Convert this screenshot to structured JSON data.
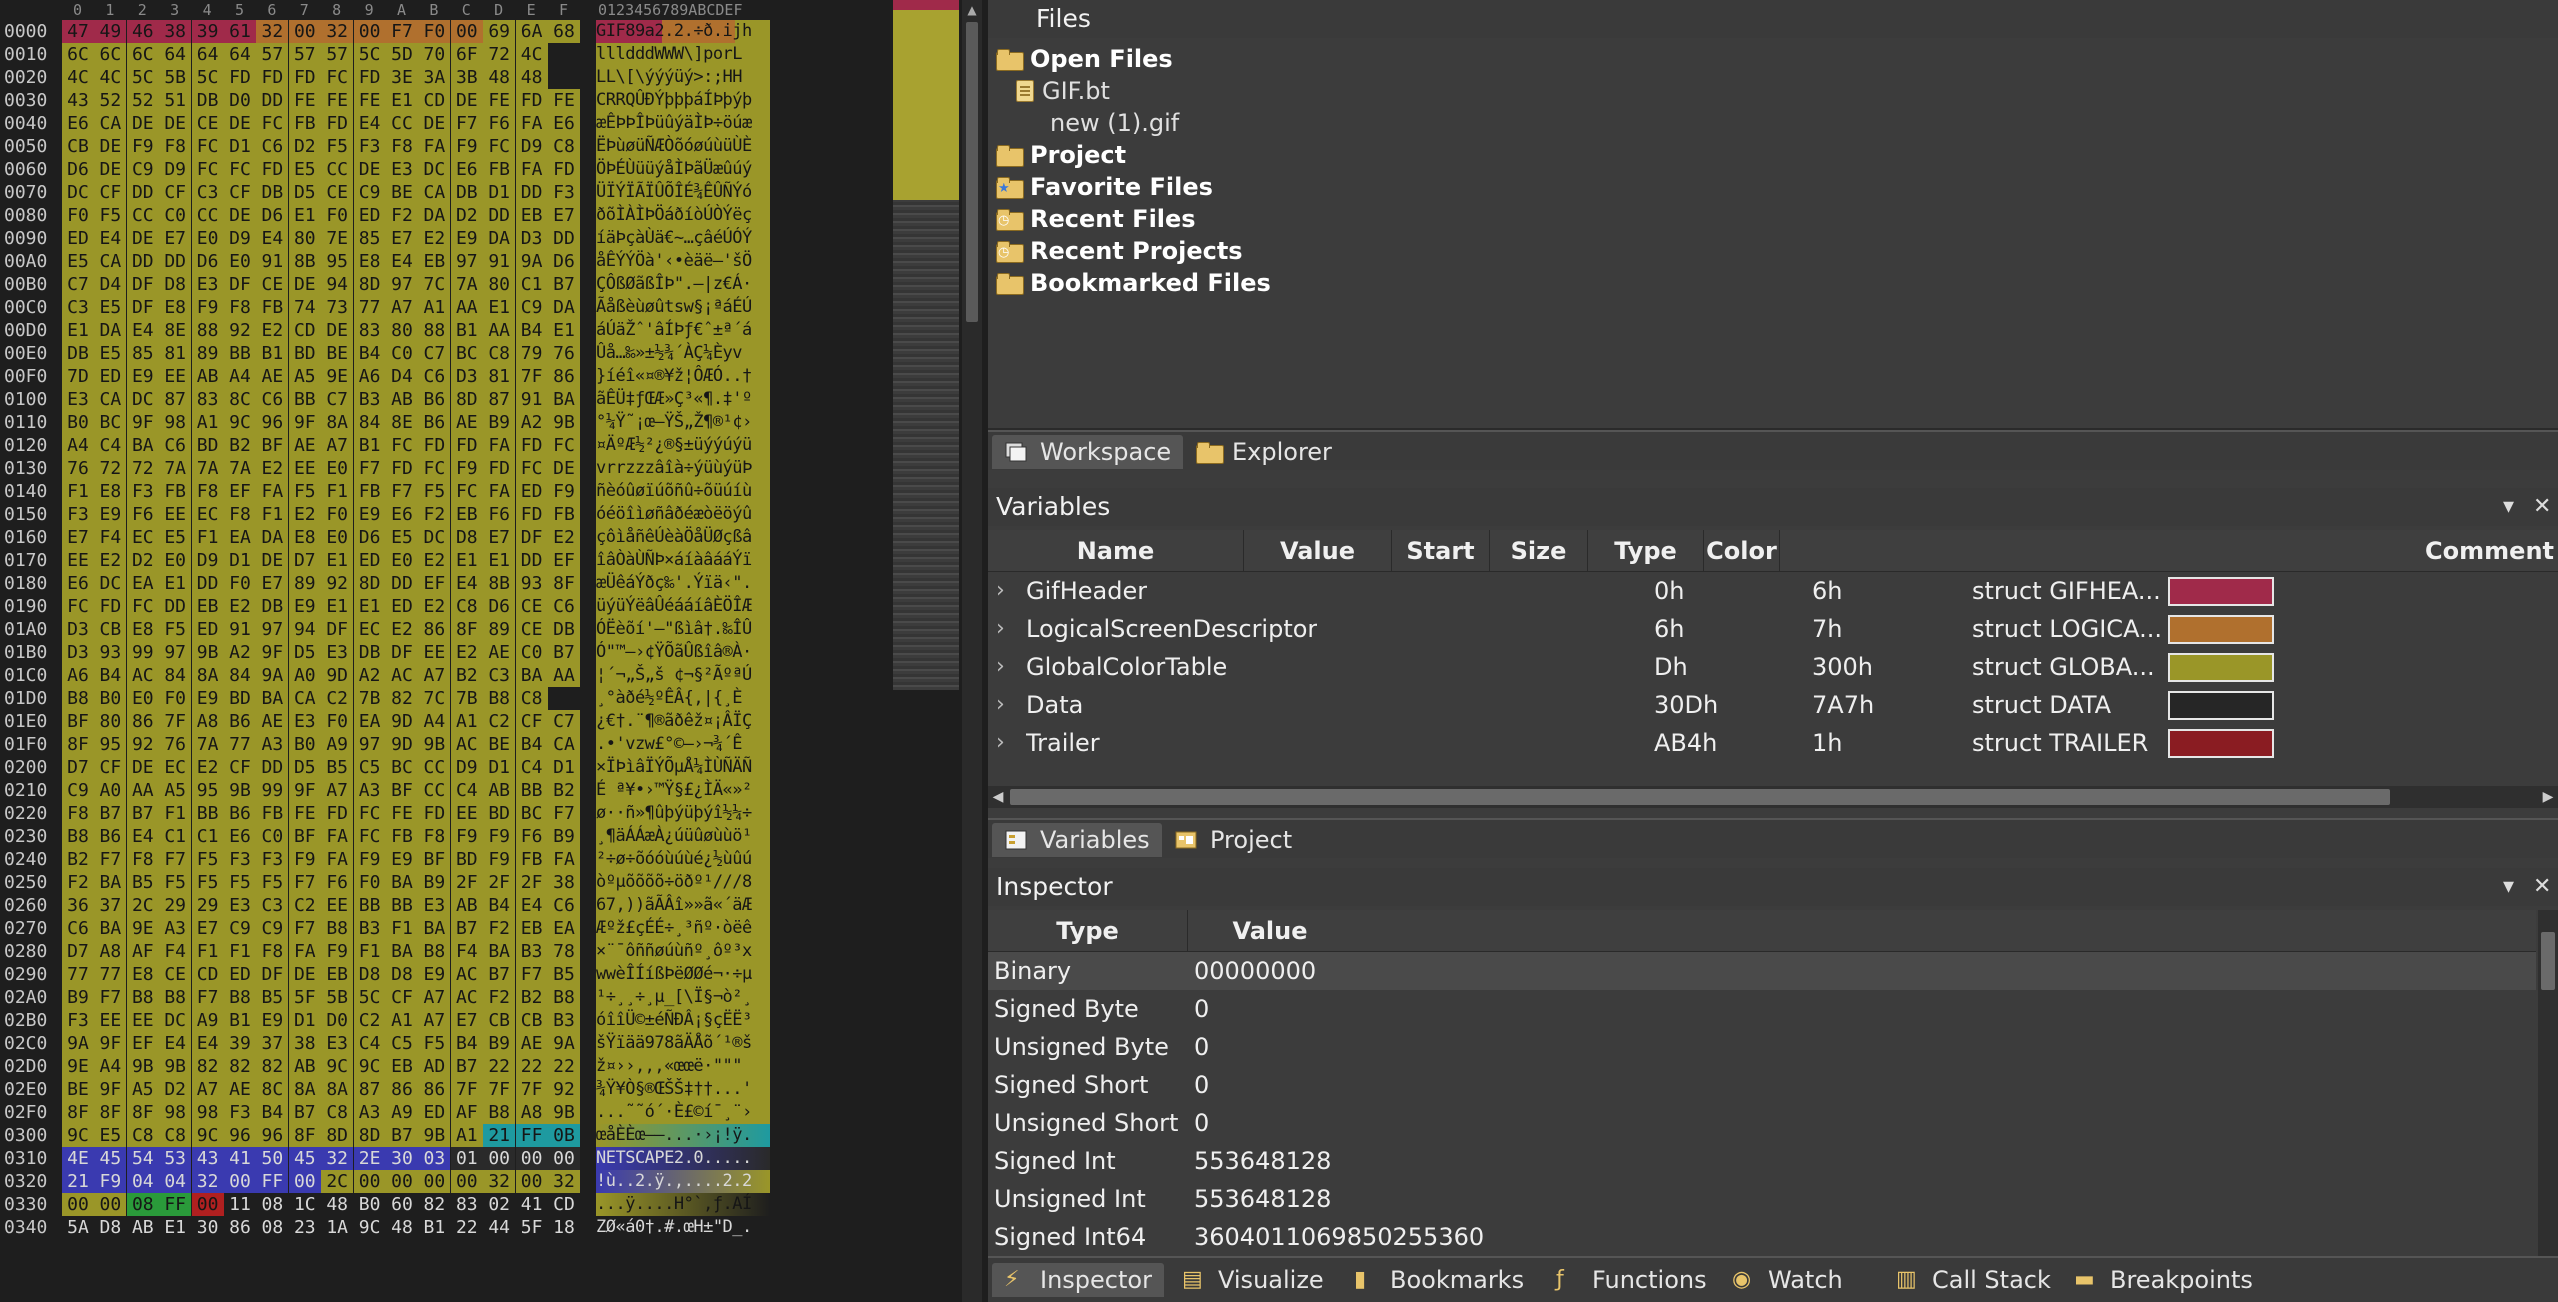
{
  "hex": {
    "column_headers": [
      "0",
      "1",
      "2",
      "3",
      "4",
      "5",
      "6",
      "7",
      "8",
      "9",
      "A",
      "B",
      "C",
      "D",
      "E",
      "F"
    ],
    "ascii_header": "0123456789ABCDEF",
    "rows": [
      {
        "addr": "0000",
        "bytes": "47 49 46 38 39 61 32 00 32 00 F7 F0 00 69 6A 68",
        "ascii": "GIF89a2.2.÷ð.ijh"
      },
      {
        "addr": "0010",
        "bytes": "6C 6C 6C 64 64 64 57 57 57 5C 5D 70 6F 72 4C",
        "ascii": "llldddWWW\\]porL"
      },
      {
        "addr": "0020",
        "bytes": "4C 4C 5C 5B 5C FD FD FD FC FD 3E 3A 3B 48 48",
        "ascii": "LL\\[\\ýýýüý>:;HH"
      },
      {
        "addr": "0030",
        "bytes": "43 52 52 51 DB D0 DD FE FE FE E1 CD DE FE FD FE",
        "ascii": "CRRQÛÐÝþþþáÍÞþýþ"
      },
      {
        "addr": "0040",
        "bytes": "E6 CA DE DE CE DE FC FB FD E4 CC DE F7 F6 FA E6",
        "ascii": "æÊÞÞÎÞüûýäÌÞ÷öúæ"
      },
      {
        "addr": "0050",
        "bytes": "CB DE F9 F8 FC D1 C6 D2 F5 F3 F8 FA F9 FC D9 C8",
        "ascii": "ËÞùøüÑÆÒõóøúùüÙÈ"
      },
      {
        "addr": "0060",
        "bytes": "D6 DE C9 D9 FC FC FD E5 CC DE E3 DC E6 FB FA FD",
        "ascii": "ÖÞÉÙüüýåÌÞãÜæûúý"
      },
      {
        "addr": "0070",
        "bytes": "DC CF DD CF C3 CF DB D5 CE C9 BE CA DB D1 DD F3",
        "ascii": "ÜÏÝÏÃÏÛÕÎÉ¾ÊÛÑÝó"
      },
      {
        "addr": "0080",
        "bytes": "F0 F5 CC C0 CC DE D6 E1 F0 ED F2 DA D2 DD EB E7",
        "ascii": "ðõÌÀÌÞÖáðíòÚÒÝëç"
      },
      {
        "addr": "0090",
        "bytes": "ED E4 DE E7 E0 D9 E4 80 7E 85 E7 E2 E9 DA D3 DD",
        "ascii": "íäÞçàÙä€~…çâéÚÓÝ"
      },
      {
        "addr": "00A0",
        "bytes": "E5 CA DD DD D6 E0 91 8B 95 E8 E4 EB 97 91 9A D6",
        "ascii": "åÊÝÝÖà'‹•èäë—'šÖ"
      },
      {
        "addr": "00B0",
        "bytes": "C7 D4 DF D8 E3 DF CE DE 94 8D 97 7C 7A 80 C1 B7",
        "ascii": "ÇÔßØãßÎÞ\".—|z€Á·"
      },
      {
        "addr": "00C0",
        "bytes": "C3 E5 DF E8 F9 F8 FB 74 73 77 A7 A1 AA E1 C9 DA",
        "ascii": "Ãåßèùøûtsw§¡ªáÉÚ"
      },
      {
        "addr": "00D0",
        "bytes": "E1 DA E4 8E 88 92 E2 CD DE 83 80 88 B1 AA B4 E1",
        "ascii": "áÚäŽˆ'âÍÞƒ€ˆ±ª´á"
      },
      {
        "addr": "00E0",
        "bytes": "DB E5 85 81 89 BB B1 BD BE B4 C0 C7 BC C8 79 76",
        "ascii": "Ûå…‰»±½¾´ÀÇ¼Èyv"
      },
      {
        "addr": "00F0",
        "bytes": "7D ED E9 EE AB A4 AE A5 9E A6 D4 C6 D3 81 7F 86",
        "ascii": "}íéî«¤®¥ž¦ÔÆÓ..†"
      },
      {
        "addr": "0100",
        "bytes": "E3 CA DC 87 83 8C C6 BB C7 B3 AB B6 8D 87 91 BA",
        "ascii": "ãÊÜ‡ƒŒÆ»Ç³«¶.‡'º"
      },
      {
        "addr": "0110",
        "bytes": "B0 BC 9F 98 A1 9C 96 9F 8A 84 8E B6 AE B9 A2 9B",
        "ascii": "°¼Ÿ˜¡œ–ŸŠ„Ž¶®¹¢›"
      },
      {
        "addr": "0120",
        "bytes": "A4 C4 BA C6 BD B2 BF AE A7 B1 FC FD FD FA FD FC",
        "ascii": "¤ÄºÆ½²¿®§±üýýúýü"
      },
      {
        "addr": "0130",
        "bytes": "76 72 72 7A 7A 7A E2 EE E0 F7 FD FC F9 FD FC DE",
        "ascii": "vrrzzzâîà÷ýüùýüÞ"
      },
      {
        "addr": "0140",
        "bytes": "F1 E8 F3 FB F8 EF FA F5 F1 FB F7 F5 FC FA ED F9",
        "ascii": "ñèóûøïúõñû÷õüúíù"
      },
      {
        "addr": "0150",
        "bytes": "F3 E9 F6 EE EC F8 F1 E2 F0 E9 E6 F2 EB F6 FD FB",
        "ascii": "óéöîìøñâðéæòëöýû"
      },
      {
        "addr": "0160",
        "bytes": "E7 F4 EC E5 F1 EA DA E8 E0 D6 E5 DC D8 E7 DF E2",
        "ascii": "çôìåñêÚèàÖåÜØçßâ"
      },
      {
        "addr": "0170",
        "bytes": "EE E2 D2 E0 D9 D1 DE D7 E1 ED E0 E2 E1 E1 DD EF",
        "ascii": "îâÒàÙÑÞ×áíàâááÝï"
      },
      {
        "addr": "0180",
        "bytes": "E6 DC EA E1 DD F0 E7 89 92 8D DD EF E4 8B 93 8F",
        "ascii": "æÜêáÝðç‰'.Ýïä‹\"."
      },
      {
        "addr": "0190",
        "bytes": "FC FD FC DD EB E2 DB E9 E1 E1 ED E2 C8 D6 CE C6",
        "ascii": "üýüÝëâÛéááíâÈÖÎÆ"
      },
      {
        "addr": "01A0",
        "bytes": "D3 CB E8 F5 ED 91 97 94 DF EC E2 86 8F 89 CE DB",
        "ascii": "ÓËèõí'—\"ßìâ†.‰ÎÛ"
      },
      {
        "addr": "01B0",
        "bytes": "D3 93 99 97 9B A2 9F D5 E3 DB DF EE E2 AE C0 B7",
        "ascii": "Ó\"™—›¢ŸÕãÛßîâ®À·"
      },
      {
        "addr": "01C0",
        "bytes": "A6 B4 AC 84 8A 84 9A A0 9D A2 AC A7 B2 C3 BA AA",
        "ascii": "¦´¬„Š„š ¢¬§²ÃºªÚ"
      },
      {
        "addr": "01D0",
        "bytes": "B8 B0 E0 F0 E9 BD BA CA C2 7B 82 7C 7B B8 C8",
        "ascii": "¸°àðé½ºÊÂ{‚|{¸È"
      },
      {
        "addr": "01E0",
        "bytes": "BF 80 86 7F A8 B6 AE E3 F0 EA 9D A4 A1 C2 CF C7",
        "ascii": "¿€†.¨¶®ãðêž¤¡ÂÏÇ"
      },
      {
        "addr": "01F0",
        "bytes": "8F 95 92 76 7A 77 A3 B0 A9 97 9D 9B AC BE B4 CA",
        "ascii": ".•'vzw£°©—›¬¾´Ê"
      },
      {
        "addr": "0200",
        "bytes": "D7 CF DE EC E2 CF DD D5 B5 C5 BC CC D9 D1 C4 D1",
        "ascii": "×ÏÞìâÏÝÕµÅ¼ÌÙÑÄÑ"
      },
      {
        "addr": "0210",
        "bytes": "C9 A0 AA A5 95 9B 99 9F A7 A3 BF CC C4 AB BB B2",
        "ascii": "É ª¥•›™Ÿ§£¿ÌÄ«»²"
      },
      {
        "addr": "0220",
        "bytes": "F8 B7 B7 F1 BB B6 FB FE FD FC FE FD EE BD BC F7",
        "ascii": "ø··ñ»¶ûþýüþýî½¼÷"
      },
      {
        "addr": "0230",
        "bytes": "B8 B6 E4 C1 C1 E6 C0 BF FA FC FB F8 F9 F9 F6 B9",
        "ascii": "¸¶äÁÁæÀ¿úüûøùùö¹"
      },
      {
        "addr": "0240",
        "bytes": "B2 F7 F8 F7 F5 F3 F3 F9 FA F9 E9 BF BD F9 FB FA",
        "ascii": "²÷ø÷õóóùúùé¿½ùûú"
      },
      {
        "addr": "0250",
        "bytes": "F2 BA B5 F5 F5 F5 F5 F7 F6 F0 BA B9 2F 2F 2F 38",
        "ascii": "òºµõõõõ÷öðº¹///8"
      },
      {
        "addr": "0260",
        "bytes": "36 37 2C 29 29 E3 C3 C2 EE BB BB E3 AB B4 E4 C6",
        "ascii": "67,))ãÃÂî»»ã«´äÆ"
      },
      {
        "addr": "0270",
        "bytes": "C6 BA 9E A3 E7 C9 C9 F7 B8 B3 F1 BA B7 F2 EB EA",
        "ascii": "Æºž£çÉÉ÷¸³ñº·òëê"
      },
      {
        "addr": "0280",
        "bytes": "D7 A8 AF F4 F1 F1 F8 FA F9 F1 BA B8 F4 BA B3 78",
        "ascii": "×¨¯ôññøúùñº¸ôº³x"
      },
      {
        "addr": "0290",
        "bytes": "77 77 E8 CE CD ED DF DE EB D8 D8 E9 AC B7 F7 B5",
        "ascii": "wwèÎÍíßÞëØØé¬·÷µ"
      },
      {
        "addr": "02A0",
        "bytes": "B9 F7 B8 B8 F7 B8 B5 5F 5B 5C CF A7 AC F2 B2 B8",
        "ascii": "¹÷¸¸÷¸µ_[\\Ï§¬ò²¸"
      },
      {
        "addr": "02B0",
        "bytes": "F3 EE EE DC A9 B1 E9 D1 D0 C2 A1 A7 E7 CB CB B3",
        "ascii": "óîîÜ©±éÑÐÂ¡§çËË³"
      },
      {
        "addr": "02C0",
        "bytes": "9A 9F EF E4 E4 39 37 38 E3 C4 C5 F5 B4 B9 AE 9A",
        "ascii": "šŸïää978ãÄÅõ´¹®š"
      },
      {
        "addr": "02D0",
        "bytes": "9E A4 9B 9B 82 82 82 AB 9C 9C EB AD B7 22 22 22",
        "ascii": "ž¤››‚‚‚«œœë­·\"\"\""
      },
      {
        "addr": "02E0",
        "bytes": "BE 9F A5 D2 A7 AE 8C 8A 8A 87 86 86 7F 7F 7F 92",
        "ascii": "¾Ÿ¥Ò§®ŒŠŠ‡††...'"
      },
      {
        "addr": "02F0",
        "bytes": "8F 8F 8F 98 98 F3 B4 B7 C8 A3 A9 ED AF B8 A8 9B",
        "ascii": "...˜˜ó´·È£©í¯¸¨›"
      },
      {
        "addr": "0300",
        "bytes": "9C E5 C8 C8 9C 96 96 8F 8D 8D B7 9B A1 21 FF 0B",
        "ascii": "œåÈÈœ––...·›¡!ÿ."
      },
      {
        "addr": "0310",
        "bytes": "4E 45 54 53 43 41 50 45 32 2E 30 03 01 00 00 00",
        "ascii": "NETSCAPE2.0....."
      },
      {
        "addr": "0320",
        "bytes": "21 F9 04 04 32 00 FF 00 2C 00 00 00 00 32 00 32",
        "ascii": "!ù..2.ÿ.,....2.2"
      },
      {
        "addr": "0330",
        "bytes": "00 00 08 FF 00 11 08 1C 48 B0 60 82 83 02 41 CD",
        "ascii": "...ÿ....H°`‚ƒ.AÍ"
      },
      {
        "addr": "0340",
        "bytes": "5A D8 AB E1 30 86 08 23 1A 9C 48 B1 22 44 5F 18",
        "ascii": "ZØ«á0†.#.œH±\"D_."
      }
    ]
  },
  "files": {
    "title": "Files",
    "items": [
      {
        "label": "Open Files",
        "kind": "folder",
        "bold": true
      },
      {
        "label": "GIF.bt",
        "kind": "file",
        "bold": false
      },
      {
        "label": "new (1).gif",
        "kind": "plain",
        "bold": false
      },
      {
        "label": "Project",
        "kind": "folder",
        "bold": true
      },
      {
        "label": "Favorite Files",
        "kind": "folder-star",
        "bold": true
      },
      {
        "label": "Recent Files",
        "kind": "folder-clock",
        "bold": true
      },
      {
        "label": "Recent Projects",
        "kind": "folder-clock",
        "bold": true
      },
      {
        "label": "Bookmarked Files",
        "kind": "folder",
        "bold": true
      }
    ]
  },
  "workspace_tabs": [
    {
      "label": "Workspace",
      "active": true
    },
    {
      "label": "Explorer",
      "active": false
    }
  ],
  "variables": {
    "title": "Variables",
    "columns": [
      "Name",
      "Value",
      "Start",
      "Size",
      "Type",
      "Color",
      "Comment"
    ],
    "rows": [
      {
        "name": "GifHeader",
        "value": "",
        "start": "0h",
        "size": "6h",
        "type": "struct GIFHEA...",
        "color": "#a02a4a"
      },
      {
        "name": "LogicalScreenDescriptor",
        "value": "",
        "start": "6h",
        "size": "7h",
        "type": "struct LOGICA...",
        "color": "#b0702e"
      },
      {
        "name": "GlobalColorTable",
        "value": "",
        "start": "Dh",
        "size": "300h",
        "type": "struct GLOBA...",
        "color": "#9a9628"
      },
      {
        "name": "Data",
        "value": "",
        "start": "30Dh",
        "size": "7A7h",
        "type": "struct DATA",
        "color": "#262626"
      },
      {
        "name": "Trailer",
        "value": "",
        "start": "AB4h",
        "size": "1h",
        "type": "struct TRAILER",
        "color": "#8a1c22"
      }
    ]
  },
  "variables_tabs": [
    {
      "label": "Variables",
      "active": true
    },
    {
      "label": "Project",
      "active": false
    }
  ],
  "inspector": {
    "title": "Inspector",
    "columns": [
      "Type",
      "Value"
    ],
    "rows": [
      {
        "type": "Binary",
        "value": "00000000"
      },
      {
        "type": "Signed Byte",
        "value": "0"
      },
      {
        "type": "Unsigned Byte",
        "value": "0"
      },
      {
        "type": "Signed Short",
        "value": "0"
      },
      {
        "type": "Unsigned Short",
        "value": "0"
      },
      {
        "type": "Signed Int",
        "value": "553648128"
      },
      {
        "type": "Unsigned Int",
        "value": "553648128"
      },
      {
        "type": "Signed Int64",
        "value": "3604011069850255360"
      }
    ]
  },
  "bottom_tabs": [
    {
      "label": "Inspector",
      "icon": "lightning-icon",
      "active": true
    },
    {
      "label": "Visualize",
      "icon": "document-icon",
      "active": false
    },
    {
      "label": "Bookmarks",
      "icon": "bookmark-icon",
      "active": false
    },
    {
      "label": "Functions",
      "icon": "function-icon",
      "active": false
    },
    {
      "label": "Watch",
      "icon": "eye-icon",
      "active": false
    },
    {
      "label": "Call Stack",
      "icon": "stack-icon",
      "active": false
    },
    {
      "label": "Breakpoints",
      "icon": "breakpoint-icon",
      "active": false
    }
  ],
  "colors": {
    "struct_header": "#a02a4a",
    "struct_lsd": "#b0702e",
    "struct_gct": "#9a9628",
    "struct_data_teal": "#1e9aa0",
    "struct_data_blue": "#3a3ab0",
    "struct_data_green": "#2a9a3a",
    "struct_trailer": "#b02020"
  }
}
